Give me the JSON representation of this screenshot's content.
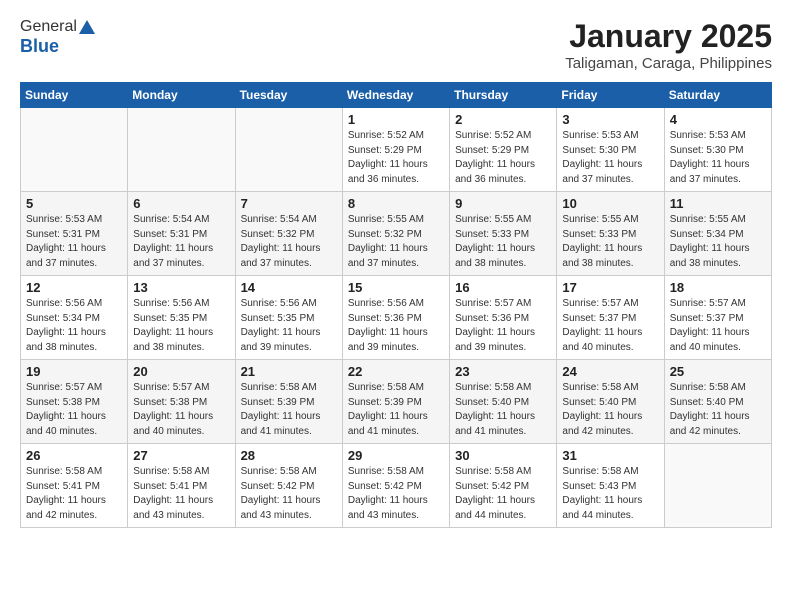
{
  "header": {
    "logo_general": "General",
    "logo_blue": "Blue",
    "month_title": "January 2025",
    "subtitle": "Taligaman, Caraga, Philippines"
  },
  "days_of_week": [
    "Sunday",
    "Monday",
    "Tuesday",
    "Wednesday",
    "Thursday",
    "Friday",
    "Saturday"
  ],
  "weeks": [
    [
      {
        "day": "",
        "info": ""
      },
      {
        "day": "",
        "info": ""
      },
      {
        "day": "",
        "info": ""
      },
      {
        "day": "1",
        "info": "Sunrise: 5:52 AM\nSunset: 5:29 PM\nDaylight: 11 hours\nand 36 minutes."
      },
      {
        "day": "2",
        "info": "Sunrise: 5:52 AM\nSunset: 5:29 PM\nDaylight: 11 hours\nand 36 minutes."
      },
      {
        "day": "3",
        "info": "Sunrise: 5:53 AM\nSunset: 5:30 PM\nDaylight: 11 hours\nand 37 minutes."
      },
      {
        "day": "4",
        "info": "Sunrise: 5:53 AM\nSunset: 5:30 PM\nDaylight: 11 hours\nand 37 minutes."
      }
    ],
    [
      {
        "day": "5",
        "info": "Sunrise: 5:53 AM\nSunset: 5:31 PM\nDaylight: 11 hours\nand 37 minutes."
      },
      {
        "day": "6",
        "info": "Sunrise: 5:54 AM\nSunset: 5:31 PM\nDaylight: 11 hours\nand 37 minutes."
      },
      {
        "day": "7",
        "info": "Sunrise: 5:54 AM\nSunset: 5:32 PM\nDaylight: 11 hours\nand 37 minutes."
      },
      {
        "day": "8",
        "info": "Sunrise: 5:55 AM\nSunset: 5:32 PM\nDaylight: 11 hours\nand 37 minutes."
      },
      {
        "day": "9",
        "info": "Sunrise: 5:55 AM\nSunset: 5:33 PM\nDaylight: 11 hours\nand 38 minutes."
      },
      {
        "day": "10",
        "info": "Sunrise: 5:55 AM\nSunset: 5:33 PM\nDaylight: 11 hours\nand 38 minutes."
      },
      {
        "day": "11",
        "info": "Sunrise: 5:55 AM\nSunset: 5:34 PM\nDaylight: 11 hours\nand 38 minutes."
      }
    ],
    [
      {
        "day": "12",
        "info": "Sunrise: 5:56 AM\nSunset: 5:34 PM\nDaylight: 11 hours\nand 38 minutes."
      },
      {
        "day": "13",
        "info": "Sunrise: 5:56 AM\nSunset: 5:35 PM\nDaylight: 11 hours\nand 38 minutes."
      },
      {
        "day": "14",
        "info": "Sunrise: 5:56 AM\nSunset: 5:35 PM\nDaylight: 11 hours\nand 39 minutes."
      },
      {
        "day": "15",
        "info": "Sunrise: 5:56 AM\nSunset: 5:36 PM\nDaylight: 11 hours\nand 39 minutes."
      },
      {
        "day": "16",
        "info": "Sunrise: 5:57 AM\nSunset: 5:36 PM\nDaylight: 11 hours\nand 39 minutes."
      },
      {
        "day": "17",
        "info": "Sunrise: 5:57 AM\nSunset: 5:37 PM\nDaylight: 11 hours\nand 40 minutes."
      },
      {
        "day": "18",
        "info": "Sunrise: 5:57 AM\nSunset: 5:37 PM\nDaylight: 11 hours\nand 40 minutes."
      }
    ],
    [
      {
        "day": "19",
        "info": "Sunrise: 5:57 AM\nSunset: 5:38 PM\nDaylight: 11 hours\nand 40 minutes."
      },
      {
        "day": "20",
        "info": "Sunrise: 5:57 AM\nSunset: 5:38 PM\nDaylight: 11 hours\nand 40 minutes."
      },
      {
        "day": "21",
        "info": "Sunrise: 5:58 AM\nSunset: 5:39 PM\nDaylight: 11 hours\nand 41 minutes."
      },
      {
        "day": "22",
        "info": "Sunrise: 5:58 AM\nSunset: 5:39 PM\nDaylight: 11 hours\nand 41 minutes."
      },
      {
        "day": "23",
        "info": "Sunrise: 5:58 AM\nSunset: 5:40 PM\nDaylight: 11 hours\nand 41 minutes."
      },
      {
        "day": "24",
        "info": "Sunrise: 5:58 AM\nSunset: 5:40 PM\nDaylight: 11 hours\nand 42 minutes."
      },
      {
        "day": "25",
        "info": "Sunrise: 5:58 AM\nSunset: 5:40 PM\nDaylight: 11 hours\nand 42 minutes."
      }
    ],
    [
      {
        "day": "26",
        "info": "Sunrise: 5:58 AM\nSunset: 5:41 PM\nDaylight: 11 hours\nand 42 minutes."
      },
      {
        "day": "27",
        "info": "Sunrise: 5:58 AM\nSunset: 5:41 PM\nDaylight: 11 hours\nand 43 minutes."
      },
      {
        "day": "28",
        "info": "Sunrise: 5:58 AM\nSunset: 5:42 PM\nDaylight: 11 hours\nand 43 minutes."
      },
      {
        "day": "29",
        "info": "Sunrise: 5:58 AM\nSunset: 5:42 PM\nDaylight: 11 hours\nand 43 minutes."
      },
      {
        "day": "30",
        "info": "Sunrise: 5:58 AM\nSunset: 5:42 PM\nDaylight: 11 hours\nand 44 minutes."
      },
      {
        "day": "31",
        "info": "Sunrise: 5:58 AM\nSunset: 5:43 PM\nDaylight: 11 hours\nand 44 minutes."
      },
      {
        "day": "",
        "info": ""
      }
    ]
  ]
}
